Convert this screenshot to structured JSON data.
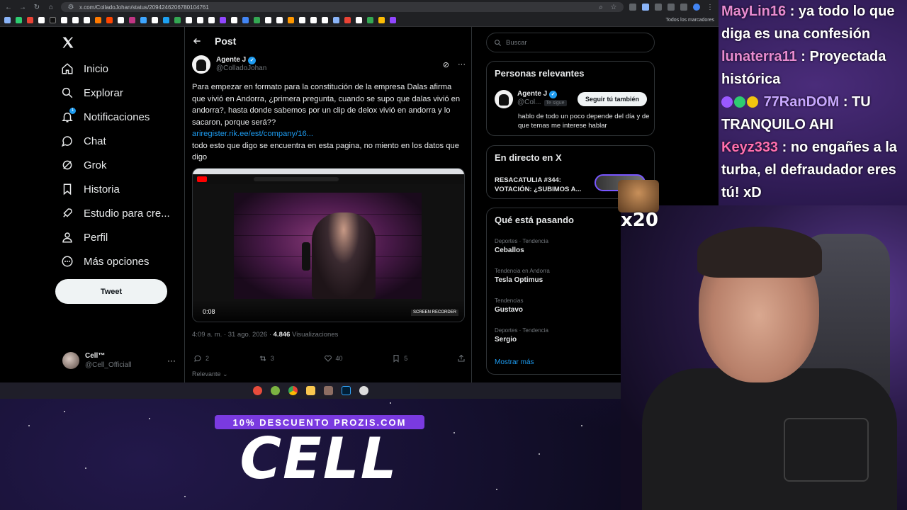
{
  "browser": {
    "url": "x.com/ColladoJohan/status/2094246206780104761",
    "bookmarks_folder": "Todos los marcadores"
  },
  "sidebar": {
    "items": [
      {
        "label": "Inicio",
        "icon": "home-icon"
      },
      {
        "label": "Explorar",
        "icon": "search-icon"
      },
      {
        "label": "Notificaciones",
        "icon": "bell-icon",
        "badge": "1"
      },
      {
        "label": "Chat",
        "icon": "chat-icon"
      },
      {
        "label": "Grok",
        "icon": "grok-icon"
      },
      {
        "label": "Historia",
        "icon": "bookmark-icon"
      },
      {
        "label": "Estudio para cre...",
        "icon": "rocket-icon"
      },
      {
        "label": "Perfil",
        "icon": "person-icon"
      },
      {
        "label": "Más opciones",
        "icon": "more-circle-icon"
      }
    ],
    "tweet_button": "Tweet",
    "account": {
      "name": "Cell™",
      "handle": "@Cell_Officiall"
    }
  },
  "post": {
    "header_title": "Post",
    "author_name": "Agente J",
    "author_handle": "@ColladoJohan",
    "text1": "Para empezar en formato para la constitución de la empresa Dalas afirma que vivió en Andorra, ¿primera pregunta, cuando se supo que dalas vivió en andorra?, hasta donde sabemos por un clip de delox vivió en andorra y lo sacaron, porque será??",
    "link": "ariregister.rik.ee/est/company/16...",
    "text2": "todo esto que digo se encuentra en esta pagina, no miento en los datos que digo",
    "video_time": "0:08",
    "recorder_label": "SCREEN RECORDER",
    "time": "4:09 a. m.",
    "date": "31 ago. 2026",
    "views_count": "4.846",
    "views_label": "Visualizaciones",
    "replies": "2",
    "reposts": "3",
    "likes": "40",
    "bookmarks": "5",
    "sort_label": "Relevante"
  },
  "right": {
    "search_placeholder": "Buscar",
    "relevant": {
      "title": "Personas relevantes",
      "name": "Agente J",
      "handle": "@Col...",
      "follows_you": "Te sigue",
      "follow_button": "Seguir tú también",
      "bio": "hablo de todo un poco depende del día y de que temas me interese hablar"
    },
    "live": {
      "title": "En directo en X",
      "stream_title": "RESACATULIA #344: VOTACIÓN: ¿SUBIMOS A..."
    },
    "trends": {
      "title": "Qué está pasando",
      "items": [
        {
          "context": "Deportes · Tendencia",
          "name": "Ceballos"
        },
        {
          "context": "Tendencia en Andorra",
          "name": "Tesla Optimus"
        },
        {
          "context": "Tendencias",
          "name": "Gustavo"
        },
        {
          "context": "Deportes · Tendencia",
          "name": "Sergio"
        }
      ],
      "show_more": "Mostrar más"
    }
  },
  "chat": [
    {
      "user": "MayLin16",
      "color": "#e88bd0",
      "message": ": ya todo lo que diga es una confesión"
    },
    {
      "user": "lunaterra11",
      "color": "#e88bd0",
      "message": ": Proyectada histórica"
    },
    {
      "user": "77RanDOM",
      "color": "#c8a8ff",
      "message": ": TU TRANQUILO AHI"
    },
    {
      "user": "Keyz333",
      "color": "#ff6fae",
      "message": ": no engañes a la turba, el defraudador eres tú! xD"
    }
  ],
  "overlay": {
    "promo": "10% DESCUENTO PROZIS.COM",
    "logo": "CELL",
    "emote_text": "x20"
  }
}
